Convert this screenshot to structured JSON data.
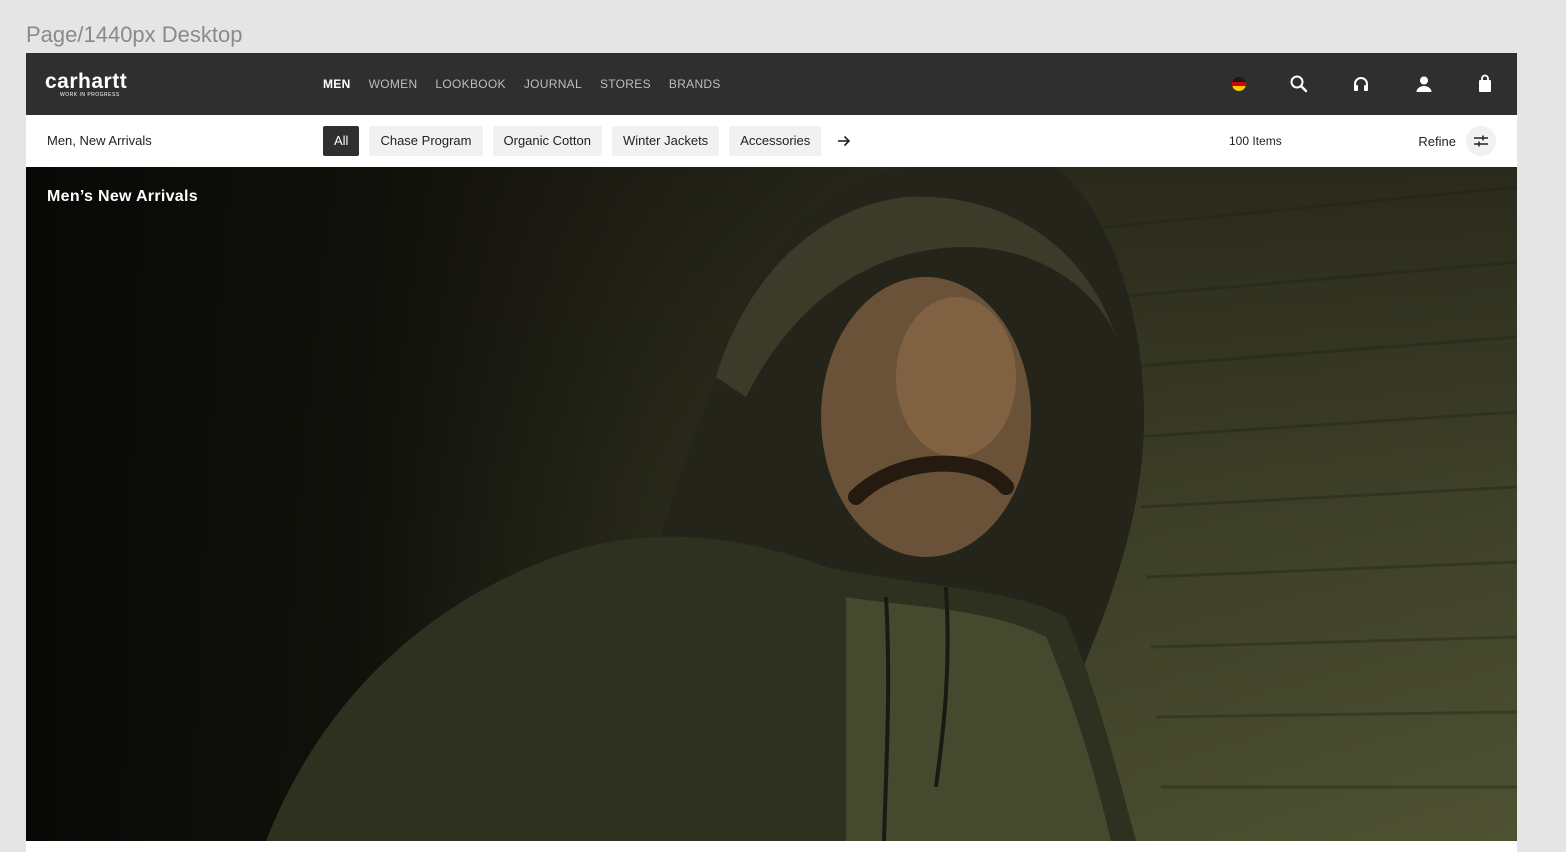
{
  "frame_label": "Page/1440px Desktop",
  "brand": {
    "name": "carhartt",
    "tagline": "WORK IN PROGRESS"
  },
  "nav": {
    "links": [
      "MEN",
      "WOMEN",
      "LOOKBOOK",
      "JOURNAL",
      "STORES",
      "BRANDS"
    ],
    "active": "MEN",
    "icons": [
      "germany-flag-icon",
      "search-icon",
      "headphones-icon",
      "user-icon",
      "shopping-bag-icon"
    ]
  },
  "filter_bar": {
    "breadcrumb": "Men, New Arrivals",
    "chips": [
      "All",
      "Chase Program",
      "Organic Cotton",
      "Winter Jackets",
      "Accessories"
    ],
    "active_chip": "All",
    "item_count": "100 Items",
    "refine_label": "Refine"
  },
  "hero": {
    "title": "Men’s New Arrivals"
  },
  "colors": {
    "nav_bg": "#2f2f2f",
    "active_chip_bg": "#2f2f2f",
    "chip_bg": "#f1f1f1",
    "page_bg": "#e5e5e5"
  }
}
